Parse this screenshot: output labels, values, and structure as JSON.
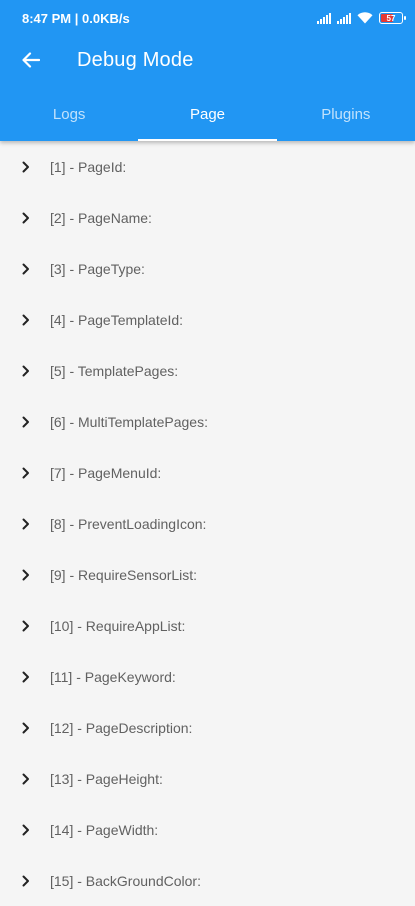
{
  "status_bar": {
    "time_speed": "8:47 PM | 0.0KB/s",
    "battery_level": "57"
  },
  "toolbar": {
    "title": "Debug Mode"
  },
  "tabs": [
    {
      "label": "Logs"
    },
    {
      "label": "Page"
    },
    {
      "label": "Plugins"
    }
  ],
  "items": [
    {
      "label": "[1] - PageId:"
    },
    {
      "label": "[2] - PageName:"
    },
    {
      "label": "[3] - PageType:"
    },
    {
      "label": "[4] - PageTemplateId:"
    },
    {
      "label": "[5] - TemplatePages:"
    },
    {
      "label": "[6] - MultiTemplatePages:"
    },
    {
      "label": "[7] - PageMenuId:"
    },
    {
      "label": "[8] - PreventLoadingIcon:"
    },
    {
      "label": "[9] - RequireSensorList:"
    },
    {
      "label": "[10] - RequireAppList:"
    },
    {
      "label": "[11] - PageKeyword:"
    },
    {
      "label": "[12] - PageDescription:"
    },
    {
      "label": "[13] - PageHeight:"
    },
    {
      "label": "[14] - PageWidth:"
    },
    {
      "label": "[15] - BackGroundColor:"
    }
  ],
  "colors": {
    "primary": "#2196f3",
    "background": "#f5f5f5",
    "text": "#616161"
  }
}
